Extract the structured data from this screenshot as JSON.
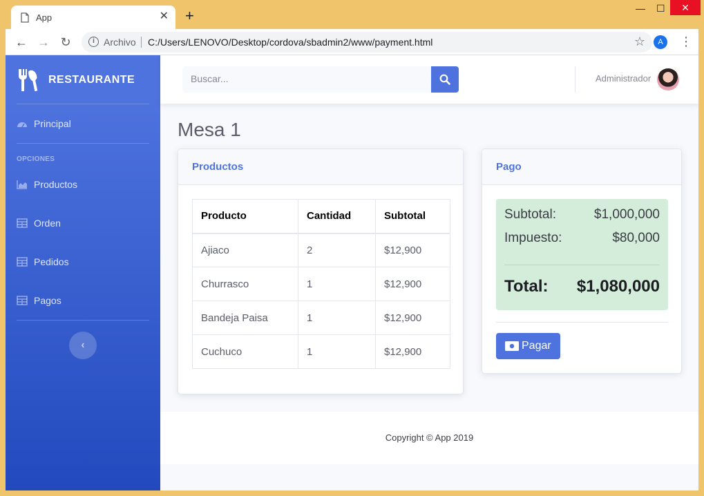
{
  "browser": {
    "tab_title": "App",
    "omnibox_label": "Archivo",
    "url": "C:/Users/LENOVO/Desktop/cordova/sbadmin2/www/payment.html",
    "profile_initial": "A"
  },
  "sidebar": {
    "brand": "RESTAURANTE",
    "section_heading": "OPCIONES",
    "items": [
      {
        "label": "Principal",
        "icon": "tachometer-icon"
      },
      {
        "label": "Productos",
        "icon": "chart-area-icon"
      },
      {
        "label": "Orden",
        "icon": "table-icon"
      },
      {
        "label": "Pedidos",
        "icon": "table-icon"
      },
      {
        "label": "Pagos",
        "icon": "table-icon"
      }
    ],
    "toggle_icon": "chevron-left-icon"
  },
  "topbar": {
    "search_placeholder": "Buscar...",
    "user_name": "Administrador"
  },
  "page": {
    "title": "Mesa 1"
  },
  "products": {
    "title": "Productos",
    "columns": [
      "Producto",
      "Cantidad",
      "Subtotal"
    ],
    "rows": [
      [
        "Ajiaco",
        "2",
        "$12,900"
      ],
      [
        "Churrasco",
        "1",
        "$12,900"
      ],
      [
        "Bandeja Paisa",
        "1",
        "$12,900"
      ],
      [
        "Cuchuco",
        "1",
        "$12,900"
      ]
    ]
  },
  "payment": {
    "title": "Pago",
    "subtotal_label": "Subtotal:",
    "subtotal_value": "$1,000,000",
    "tax_label": "Impuesto:",
    "tax_value": "$80,000",
    "total_label": "Total:",
    "total_value": "$1,080,000",
    "pay_button": "Pagar"
  },
  "footer": {
    "copyright": "Copyright © App 2019"
  },
  "colors": {
    "primary": "#4e73df",
    "success_bg": "#d4edda",
    "window_frame": "#f0c46a"
  }
}
